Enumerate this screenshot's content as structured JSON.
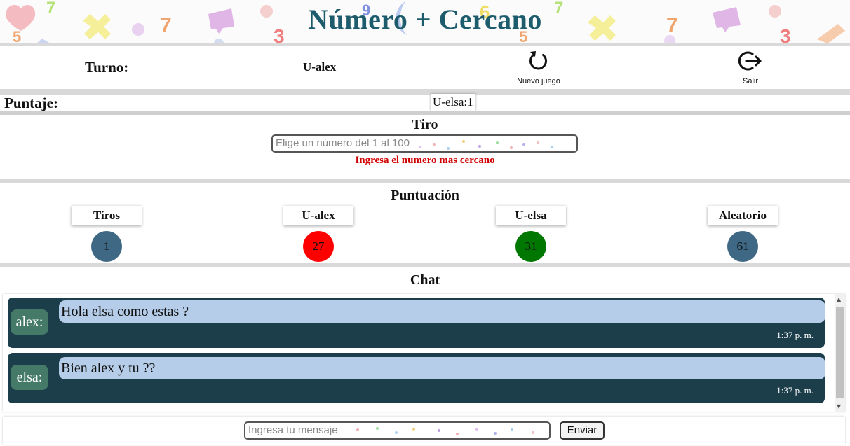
{
  "app": {
    "title": "Número + Cercano",
    "colors": {
      "title": "#1d5c6c",
      "chat_bg": "#1c3e4b",
      "bubble": "#b5cde8",
      "name_tag": "#457a69",
      "error": "#d10000"
    }
  },
  "header_decorations": [
    "7",
    "7",
    "5",
    "3",
    "6",
    "9",
    "7",
    "7",
    "3",
    "5"
  ],
  "topbar": {
    "turn_label": "Turno:",
    "turn_value": "U-alex",
    "new_game": {
      "label": "Nuevo juego",
      "icon": "refresh-icon"
    },
    "exit": {
      "label": "Salir",
      "icon": "logout-icon"
    }
  },
  "score": {
    "label": "Puntaje:",
    "value": "U-elsa:1"
  },
  "tiro": {
    "title": "Tiro",
    "placeholder": "Elige un número del 1 al 100",
    "error": "Ingresa el numero mas cercano"
  },
  "puntuacion": {
    "title": "Puntuación",
    "columns": [
      {
        "label": "Tiros",
        "value": "1",
        "color": "#3f6884"
      },
      {
        "label": "U-alex",
        "value": "27",
        "color": "#ff0000"
      },
      {
        "label": "U-elsa",
        "value": "31",
        "color": "#007700"
      },
      {
        "label": "Aleatorio",
        "value": "61",
        "color": "#3f6884"
      }
    ]
  },
  "chat": {
    "title": "Chat",
    "messages": [
      {
        "user": "alex:",
        "text": "Hola elsa como estas ?",
        "time": "1:37 p. m."
      },
      {
        "user": "elsa:",
        "text": "Bien alex y tu ??",
        "time": "1:37 p. m."
      }
    ],
    "input_placeholder": "Ingresa tu mensaje",
    "send_label": "Enviar"
  }
}
